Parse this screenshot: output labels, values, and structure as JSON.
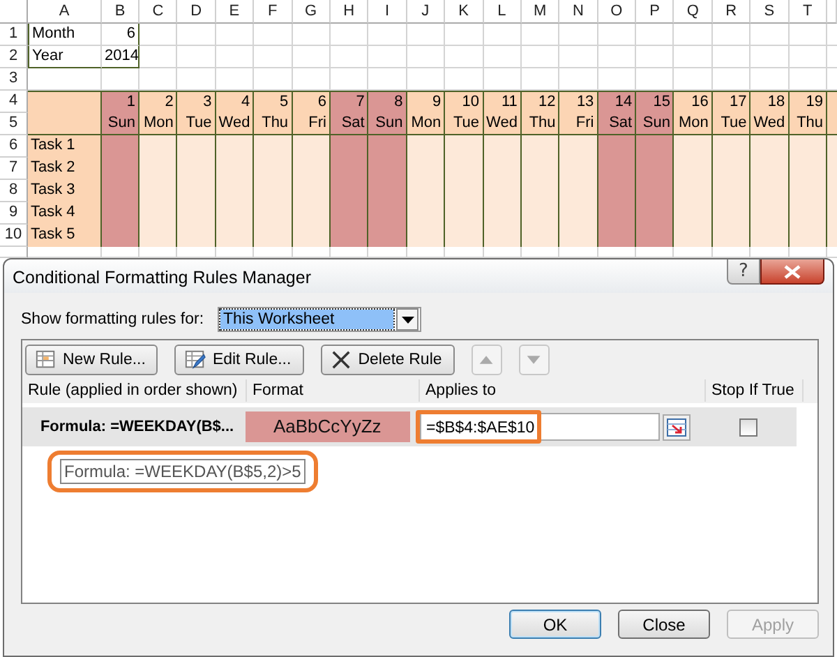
{
  "sheet": {
    "columns": [
      "A",
      "B",
      "C",
      "D",
      "E",
      "F",
      "G",
      "H",
      "I",
      "J",
      "K",
      "L",
      "M",
      "N",
      "O",
      "P",
      "Q",
      "R",
      "S",
      "T"
    ],
    "rows": [
      "1",
      "2",
      "3",
      "4",
      "5",
      "6",
      "7",
      "8",
      "9",
      "10"
    ],
    "inputs": [
      {
        "label": "Month",
        "value": "6"
      },
      {
        "label": "Year",
        "value": "2014"
      }
    ],
    "days": [
      {
        "day": "1",
        "weekday": "Sun",
        "weekend": true
      },
      {
        "day": "2",
        "weekday": "Mon",
        "weekend": false
      },
      {
        "day": "3",
        "weekday": "Tue",
        "weekend": false
      },
      {
        "day": "4",
        "weekday": "Wed",
        "weekend": false
      },
      {
        "day": "5",
        "weekday": "Thu",
        "weekend": false
      },
      {
        "day": "6",
        "weekday": "Fri",
        "weekend": false
      },
      {
        "day": "7",
        "weekday": "Sat",
        "weekend": true
      },
      {
        "day": "8",
        "weekday": "Sun",
        "weekend": true
      },
      {
        "day": "9",
        "weekday": "Mon",
        "weekend": false
      },
      {
        "day": "10",
        "weekday": "Tue",
        "weekend": false
      },
      {
        "day": "11",
        "weekday": "Wed",
        "weekend": false
      },
      {
        "day": "12",
        "weekday": "Thu",
        "weekend": false
      },
      {
        "day": "13",
        "weekday": "Fri",
        "weekend": false
      },
      {
        "day": "14",
        "weekday": "Sat",
        "weekend": true
      },
      {
        "day": "15",
        "weekday": "Sun",
        "weekend": true
      },
      {
        "day": "16",
        "weekday": "Mon",
        "weekend": false
      },
      {
        "day": "17",
        "weekday": "Tue",
        "weekend": false
      },
      {
        "day": "18",
        "weekday": "Wed",
        "weekend": false
      },
      {
        "day": "19",
        "weekday": "Thu",
        "weekend": false
      }
    ],
    "tasks": [
      "Task 1",
      "Task 2",
      "Task 3",
      "Task 4",
      "Task 5"
    ]
  },
  "dialog": {
    "title": "Conditional Formatting Rules Manager",
    "help": "?",
    "scope": {
      "label": "Show formatting rules for:",
      "value": "This Worksheet"
    },
    "toolbar": [
      {
        "kind": "new",
        "label": "New Rule..."
      },
      {
        "kind": "edit",
        "label": "Edit Rule..."
      },
      {
        "kind": "delete",
        "label": "Delete Rule"
      },
      {
        "kind": "up",
        "disabled": true
      },
      {
        "kind": "down",
        "disabled": true
      }
    ],
    "table": {
      "columns": [
        "Rule (applied in order shown)",
        "Format",
        "Applies to",
        "Stop If True"
      ],
      "rows": [
        {
          "rule": "Formula: =WEEKDAY(B$...",
          "format": "AaBbCcYyZz",
          "applies_to": "=$B$4:$AE$10",
          "stop_if_true": false,
          "selected": true
        }
      ]
    },
    "tooltip": "Formula: =WEEKDAY(B$5,2)>5",
    "buttons": [
      {
        "label": "OK",
        "disabled": false,
        "default": true
      },
      {
        "label": "Close",
        "disabled": false,
        "default": false
      },
      {
        "label": "Apply",
        "disabled": true,
        "default": false
      }
    ]
  }
}
